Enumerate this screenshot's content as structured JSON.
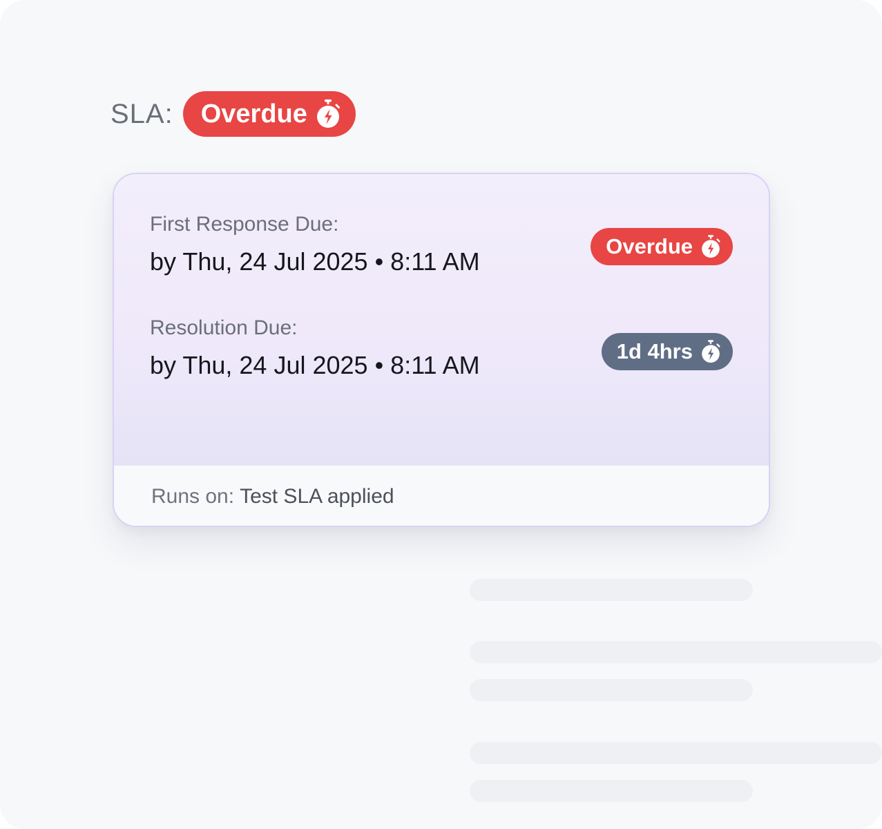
{
  "sla": {
    "label": "SLA:",
    "status_badge": "Overdue"
  },
  "card": {
    "first_response": {
      "label": "First Response Due:",
      "value": "by Thu, 24 Jul 2025 • 8:11 AM",
      "badge": "Overdue"
    },
    "resolution": {
      "label": "Resolution Due:",
      "value": "by Thu, 24 Jul 2025 • 8:11 AM",
      "badge": "1d 4hrs"
    },
    "footer": {
      "label": "Runs on:",
      "value": "Test SLA applied"
    }
  },
  "colors": {
    "overdue_badge": "#e84545",
    "timer_badge": "#5f6e85",
    "card_border": "#d8d2f3"
  },
  "icons": {
    "badge_icon": "stopwatch-bolt-icon"
  }
}
